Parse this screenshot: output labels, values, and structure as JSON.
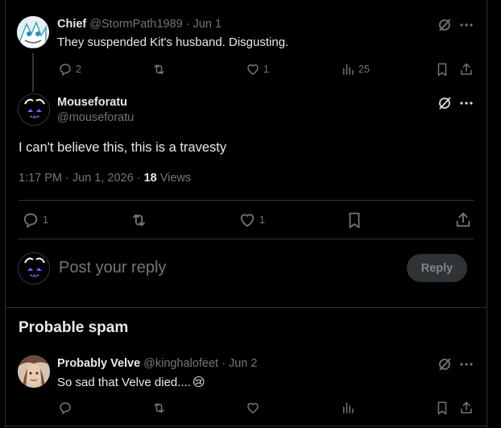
{
  "prev_tweet": {
    "author": "Chief",
    "handle": "@StormPath1989",
    "date": "· Jun 1",
    "text": "They suspended Kit's husband. Disgusting.",
    "replies": "2",
    "likes": "1",
    "views": "25"
  },
  "main_tweet": {
    "author": "Mouseforatu",
    "handle": "@mouseforatu",
    "text": "I can't believe this, this is a travesty",
    "timestamp": "1:17 PM · Jun 1, 2026 · ",
    "views_count": "18",
    "views_label": " Views",
    "replies": "1",
    "likes": "1"
  },
  "compose": {
    "placeholder": "Post your reply",
    "button": "Reply"
  },
  "spam_section": {
    "heading": "Probable spam"
  },
  "spam_tweet": {
    "author": "Probably Velve",
    "handle": "@kinghalofeet",
    "date": "· Jun 2",
    "text": "So sad that Velve died....",
    "emoji": "😢"
  },
  "colors": {
    "background": "#000000",
    "muted": "#71767b",
    "border": "#2f3336",
    "text": "#e7e9ea"
  }
}
